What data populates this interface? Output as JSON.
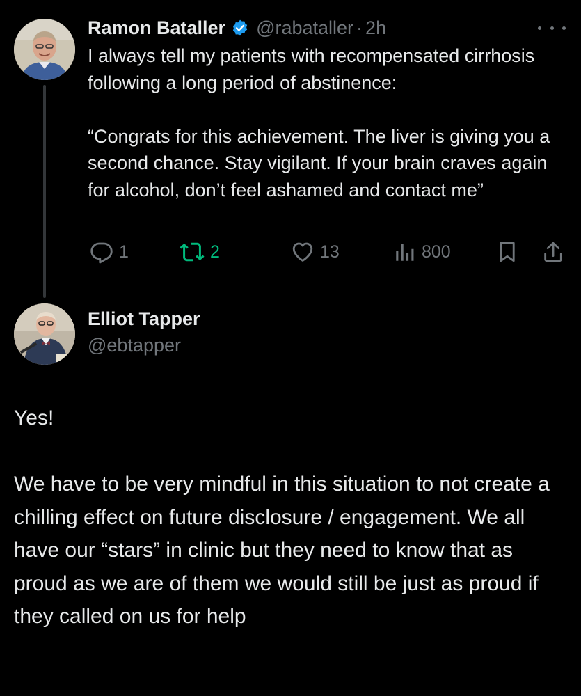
{
  "parent_tweet": {
    "author_name": "Ramon Bataller",
    "verified": true,
    "handle": "@rabataller",
    "separator": "·",
    "time": "2h",
    "avatar_icon": "avatar-photo",
    "paragraphs": [
      "I always tell my patients with recompensated cirrhosis following a long period of abstinence:",
      "“Congrats for this achievement. The liver is giving you a second chance. Stay vigilant. If your brain craves again for alcohol, don’t feel ashamed and contact me”"
    ],
    "actions": {
      "replies": "1",
      "retweets": "2",
      "likes": "13",
      "views": "800"
    }
  },
  "reply_tweet": {
    "author_name": "Elliot Tapper",
    "handle": "@ebtapper",
    "avatar_icon": "avatar-photo",
    "paragraphs": [
      "Yes!",
      "We have to be very mindful in this situation to not create a chilling effect on future disclosure / engagement. We all have our “stars” in clinic but they need to know that as proud as we are of them we would still be just as proud if they called on us for help"
    ]
  },
  "colors": {
    "background": "#000000",
    "text_primary": "#e7e9ea",
    "text_secondary": "#71767b",
    "verified_blue": "#1d9bf0",
    "retweet_green": "#00ba7c",
    "thread_line": "#333639"
  }
}
